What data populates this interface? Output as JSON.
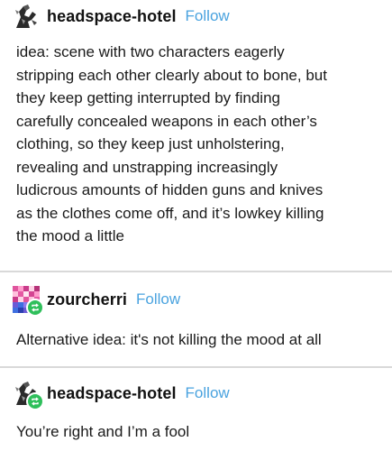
{
  "posts": [
    {
      "username": "headspace-hotel",
      "follow_label": "Follow",
      "lines": [
        "idea: scene with two characters eagerly",
        "stripping each other clearly about to bone, but",
        "they keep getting interrupted by finding",
        "carefully concealed weapons in each other’s",
        "clothing, so they keep just unholstering,",
        "revealing and unstrapping increasingly",
        "ludicrous amounts of hidden guns and knives",
        "as the clothes come off, and it’s lowkey killing",
        "the mood a little"
      ]
    },
    {
      "username": "zourcherri",
      "follow_label": "Follow",
      "lines": [
        "Alternative idea: it's not killing the mood at all"
      ]
    },
    {
      "username": "headspace-hotel",
      "follow_label": "Follow",
      "lines": [
        "You’re right and I’m a fool"
      ]
    }
  ],
  "colors": {
    "follow": "#4aa3df",
    "reblog_badge": "#2fbf5b",
    "divider": "#d9d9d9"
  },
  "icons": {
    "post1_avatar": "sketch-figure-avatar-icon",
    "post2_avatar": "pixel-avatar-icon",
    "post3_avatar": "sketch-figure-avatar-icon",
    "reblog_badge": "reblog-icon"
  }
}
